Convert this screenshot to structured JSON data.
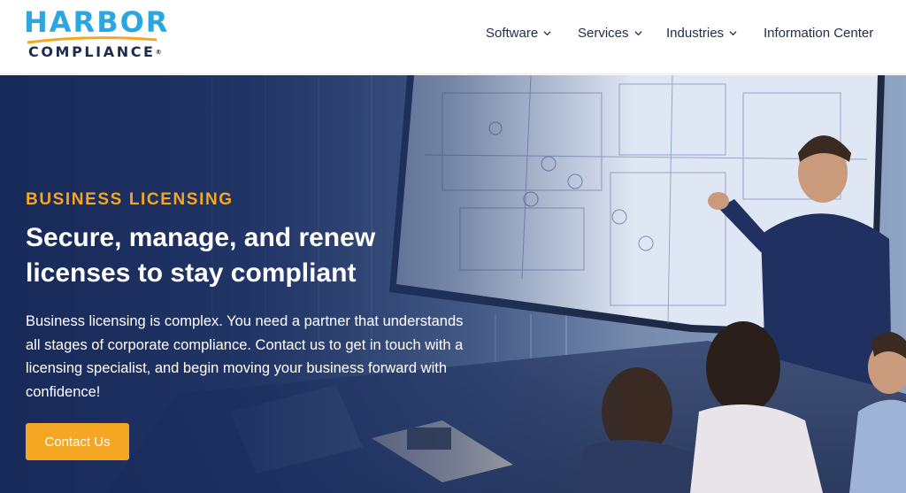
{
  "brand": {
    "name_top": "HARBOR",
    "name_bottom": "COMPLIANCE",
    "registered": "®",
    "color_primary": "#2aa7e0",
    "color_dark": "#1d2b4e",
    "color_accent": "#f5a623"
  },
  "nav": {
    "items": [
      {
        "label": "Software",
        "icon": "chevron-down-icon"
      },
      {
        "label": "Services",
        "icon": "chevron-down-icon"
      },
      {
        "label": "Industries",
        "icon": "chevron-down-icon"
      },
      {
        "label": "Information Center"
      }
    ]
  },
  "hero": {
    "eyebrow": "BUSINESS LICENSING",
    "headline": "Secure, manage, and renew licenses to stay compliant",
    "body": "Business licensing is complex. You need a partner that understands all stages of corporate compliance. Contact us to get in touch with a licensing specialist, and begin moving your business forward with confidence!",
    "cta_label": "Contact Us"
  }
}
